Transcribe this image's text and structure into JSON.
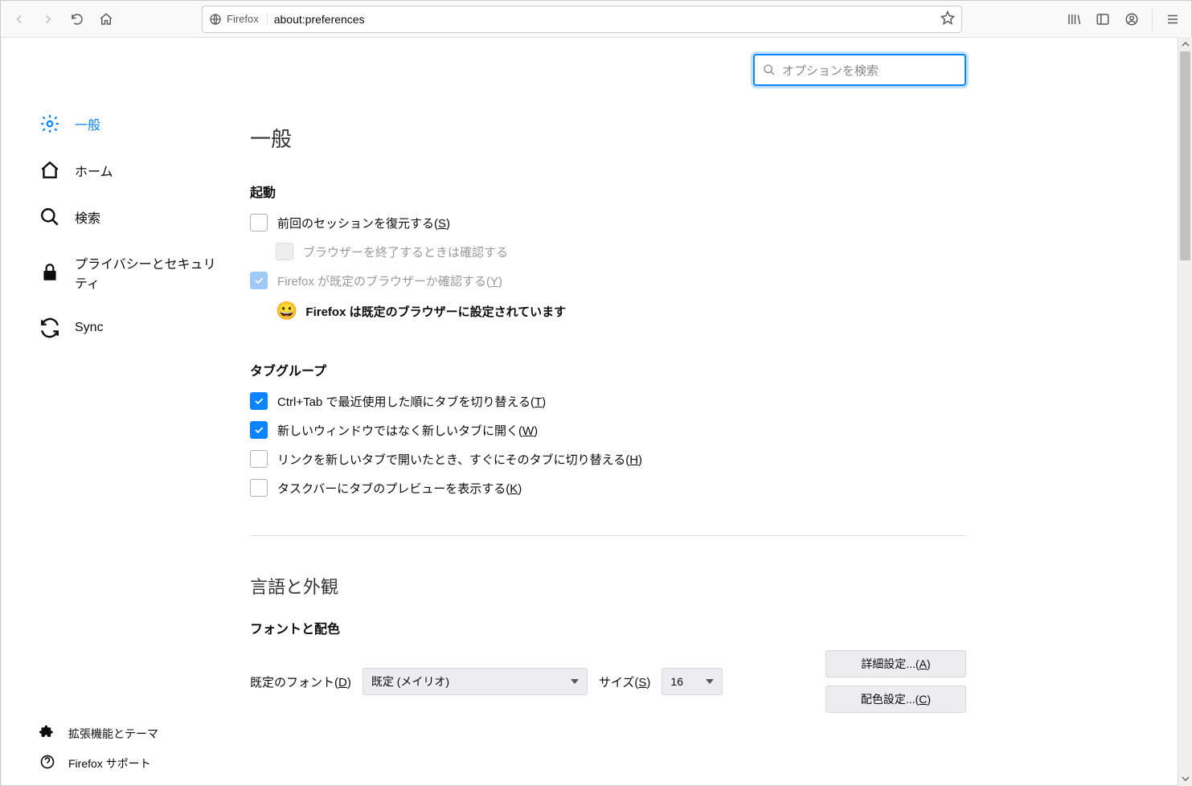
{
  "toolbar": {
    "identity_label": "Firefox",
    "url": "about:preferences"
  },
  "search": {
    "placeholder": "オプションを検索"
  },
  "sidebar": {
    "items": [
      {
        "label": "一般"
      },
      {
        "label": "ホーム"
      },
      {
        "label": "検索"
      },
      {
        "label": "プライバシーとセキュリティ"
      },
      {
        "label": "Sync"
      }
    ],
    "bottom": {
      "extensions": "拡張機能とテーマ",
      "support": "Firefox サポート"
    }
  },
  "main": {
    "heading_general": "一般",
    "startup": {
      "title": "起動",
      "restore_label_pre": "前回のセッションを復元する(",
      "restore_key": "S",
      "restore_label_post": ")",
      "warn_on_quit": "ブラウザーを終了するときは確認する",
      "default_check_pre": "Firefox が既定のブラウザーか確認する(",
      "default_check_key": "Y",
      "default_check_post": ")",
      "default_status": "Firefox は既定のブラウザーに設定されています",
      "emoji": "😀"
    },
    "tabs": {
      "title": "タブグループ",
      "ctrltab_pre": "Ctrl+Tab で最近使用した順にタブを切り替える(",
      "ctrltab_key": "T",
      "ctrltab_post": ")",
      "newtab_pre": "新しいウィンドウではなく新しいタブに開く(",
      "newtab_key": "W",
      "newtab_post": ")",
      "switch_pre": "リンクを新しいタブで開いたとき、すぐにそのタブに切り替える(",
      "switch_key": "H",
      "switch_post": ")",
      "preview_pre": "タスクバーにタブのプレビューを表示する(",
      "preview_key": "K",
      "preview_post": ")"
    },
    "lang": {
      "heading": "言語と外観",
      "fonts_title": "フォントと配色",
      "default_font_label_pre": "既定のフォント(",
      "default_font_key": "D",
      "default_font_label_post": ")",
      "default_font_value": "既定 (メイリオ)",
      "size_label_pre": "サイズ(",
      "size_key": "S",
      "size_label_post": ")",
      "size_value": "16",
      "advanced_pre": "詳細設定...(",
      "advanced_key": "A",
      "advanced_post": ")",
      "colors_pre": "配色設定...(",
      "colors_key": "C",
      "colors_post": ")"
    }
  }
}
